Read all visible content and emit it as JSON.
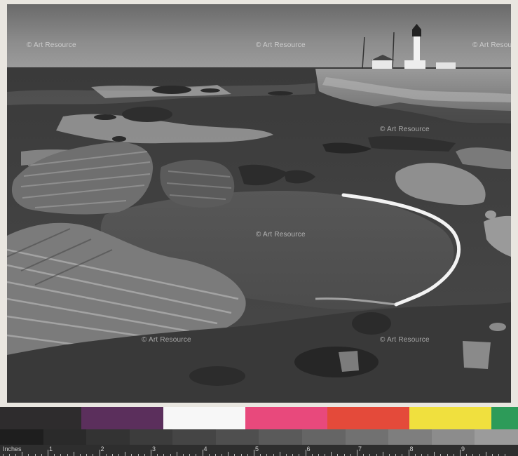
{
  "watermark": "© Art Resource",
  "ruler": {
    "unit_label": "Inches",
    "numbers": [
      "1",
      "2",
      "3",
      "4",
      "5",
      "6",
      "7",
      "8",
      "9"
    ]
  },
  "color_swatches": [
    "#2e2c2d",
    "#5b2f5c",
    "#f7f7f7",
    "#e8497c",
    "#e44a3a",
    "#f0e03e",
    "#2d9b59"
  ],
  "gray_swatches": [
    "#1e1e1e",
    "#2a2a2a",
    "#333333",
    "#3c3c3c",
    "#454545",
    "#4f4f4f",
    "#5a5a5a",
    "#656565",
    "#717171",
    "#7e7e7e",
    "#8c8c8c",
    "#9b9b9b"
  ],
  "photo": {
    "subject": "lighthouse on rocky coastline"
  }
}
